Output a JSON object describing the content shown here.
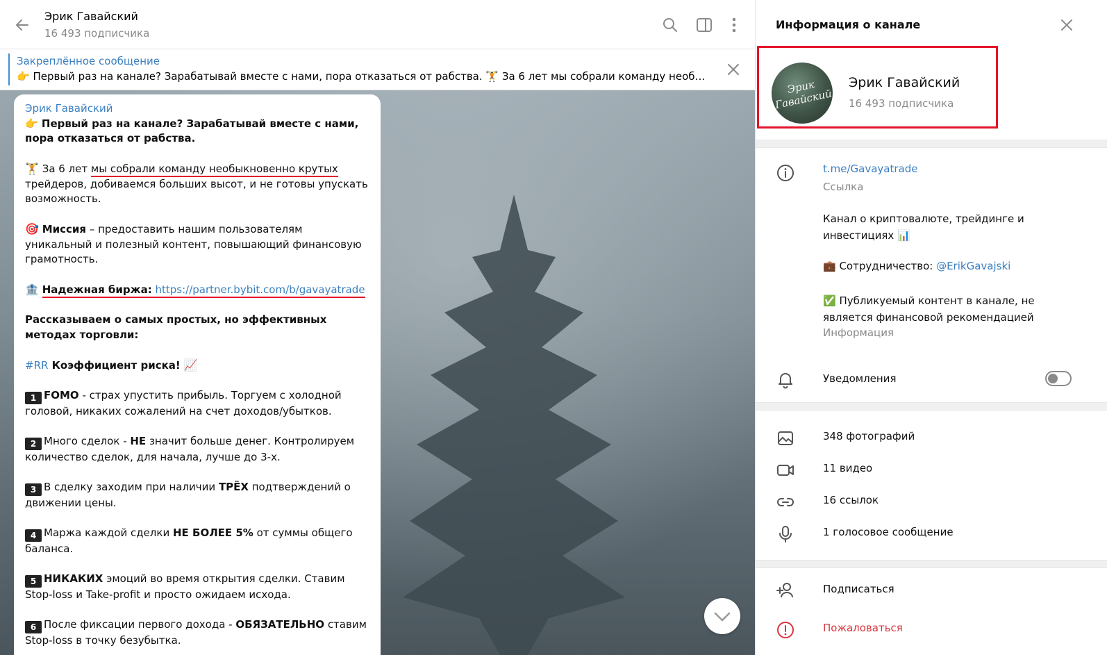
{
  "chat": {
    "title": "Эрик Гавайский",
    "subscribers": "16 493 подписчика",
    "pinned": {
      "title": "Закреплённое сообщение",
      "text": "👉 Первый раз на канале? Зарабатывай вместе с нами, пора отказаться от рабства.  🏋 За 6 лет мы собрали команду необ…"
    },
    "message": {
      "author": "Эрик Гавайский",
      "intro_bold": "👉 Первый раз на канале? Зарабатывай вместе с нами, пора отказаться от рабства.",
      "team_prefix": "За 6 лет ",
      "team_underlined": "мы собрали команду необыкновенно крутых",
      "team_suffix": " трейдеров, добиваемся больших высот, и не готовы упускать возможность.",
      "mission_bold": "Миссия",
      "mission_text": " – предоставить нашим пользователям уникальный и полезный контент, повышающий финансовую грамотность.",
      "exchange_bold": "Надежная биржа:",
      "exchange_link": "https://partner.bybit.com/b/gavayatrade",
      "methods_bold": "Рассказываем о самых простых, но эффективных методах торговли:",
      "rr_tag": "#RR",
      "rr_bold": " Коэффициент риска!",
      "items": [
        {
          "num": "1",
          "bold": "FOMO",
          "text": " - страх упустить прибыль. Торгуем с холодной головой, никаких сожалений на счет доходов/убытков."
        },
        {
          "num": "2",
          "pre": "Много сделок - ",
          "bold": "НЕ",
          "text": " значит больше денег. Контролируем количество сделок, для начала, лучше до 3-х."
        },
        {
          "num": "3",
          "pre": "В сделку заходим при наличии ",
          "bold": "ТРЁХ",
          "text": " подтверждений о движении цены."
        },
        {
          "num": "4",
          "pre": "Маржа каждой сделки ",
          "bold": "НЕ БОЛЕЕ 5%",
          "text": " от суммы общего баланса."
        },
        {
          "num": "5",
          "bold": "НИКАКИХ",
          "text": " эмоций во время открытия сделки. Ставим Stop-loss и Take-profit и просто ожидаем исхода."
        },
        {
          "num": "6",
          "pre": "После фиксации первого дохода - ",
          "bold": "ОБЯЗАТЕЛЬНО",
          "text": " ставим Stop-loss в точку безубытка."
        }
      ]
    }
  },
  "info": {
    "title": "Информация о канале",
    "name": "Эрик Гавайский",
    "subscribers": "16 493 подписчика",
    "avatar_text": "Эрик Гавайский",
    "link": "t.me/Gavayatrade",
    "link_caption": "Ссылка",
    "description_1": "Канал о криптовалюте, трейдинге и инвестициях 📊",
    "description_2_prefix": "💼 Сотрудничество: ",
    "description_2_handle": "@ErikGavajski",
    "description_3": "✅ Публикуемый контент в канале, не является финансовой рекомендацией",
    "description_caption": "Информация",
    "notifications": "Уведомления",
    "notifications_on": false,
    "media": {
      "photos": "348 фотографий",
      "videos": "11 видео",
      "links": "16 ссылок",
      "voice": "1 голосовое сообщение"
    },
    "subscribe": "Подписаться",
    "report": "Пожаловаться"
  },
  "colors": {
    "accent": "#3a7fc0",
    "highlight": "#e3142b",
    "muted": "#8a8a8a",
    "report": "#d9363e"
  },
  "icons": [
    "back-arrow-icon",
    "search-icon",
    "sidebar-toggle-icon",
    "more-vertical-icon",
    "close-icon",
    "info-icon",
    "bell-icon",
    "photo-icon",
    "video-icon",
    "link-icon",
    "microphone-icon",
    "add-user-icon",
    "report-icon",
    "chevron-down-icon"
  ]
}
